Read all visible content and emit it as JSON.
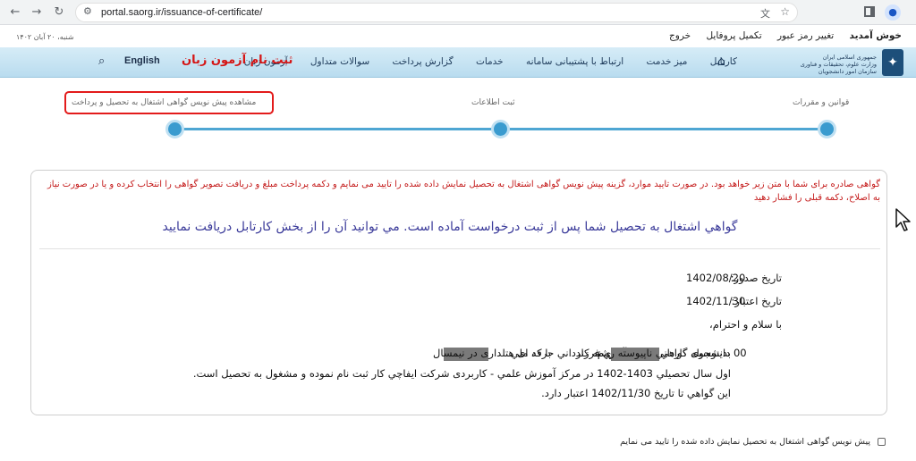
{
  "browser": {
    "url": "portal.saorg.ir/issuance-of-certificate/",
    "back_icon": "back-arrow-icon",
    "forward_icon": "forward-arrow-icon",
    "reload_icon": "reload-icon"
  },
  "topbar": {
    "welcome": "خوش آمدید",
    "change_password": "تغییر رمز عبور",
    "complete_profile": "تکمیل پروفایل",
    "logout": "خروج",
    "date": "شنبه، ۲۰ آبان ۱۴۰۲"
  },
  "logo": {
    "line1": "جمهوری اسلامی ایران",
    "line2": "وزارت علوم، تحقیقات و فناوری",
    "line3": "سازمان امور دانشجویان"
  },
  "nav": {
    "items": [
      "کارتابل",
      "میز خدمت",
      "ارتباط با پشتیبانی سامانه",
      "خدمات",
      "گزارش پرداخت",
      "سوالات متداول",
      "آزمون زبان"
    ],
    "register_language_exam": "ثبت نام آزمون زبان",
    "english": "English"
  },
  "stepper": {
    "steps": [
      "قوانین و مقررات",
      "ثبت اطلاعات",
      "مشاهده پیش نویس گواهی اشتغال به تحصیل و پرداخت"
    ],
    "active_index": 2
  },
  "content": {
    "warning": "گواهی صادره برای شما با متن زیر خواهد بود. در صورت تایید موارد، گزینه پیش نویس گواهی اشتغال به تحصیل نمایش داده شده را تایید می نمایم و دکمه پرداخت مبلغ و دریافت تصویر گواهی را انتخاب کرده و یا در صورت نیاز به اصلاح، دکمه قبلی را فشار دهید",
    "certificate_notice": "گواهي اشتغال به تحصيل شما پس از ثبت درخواست آماده است. مي توانيد آن را از بخش كارتابل دریافت نمایید",
    "issue_date_label": "تاريخ صدور:",
    "issue_date": "1402/08/20",
    "validity_date_label": "تاريخ اعتبار:",
    "validity_date": "1402/11/30",
    "greeting": "با سلام و احترام،",
    "body_part1": "بدينوسيله گواهي ميشود آقاي م",
    "body_part2": "ي فرزند",
    "body_part3": "با كد ملي",
    "body_part4": "00 دانشجوی كارداني ناپيوسته رشته كارداني حرفه ای هتلداری در نيمسال",
    "body_line2": "اول سال تحصيلي 1403-1402 در مركز آموزش علمي - كاربردی شركت ايفاچي كار ثبت نام نموده و مشغول به تحصيل است.",
    "body_line3": "اين گواهي تا تاريخ 1402/11/30 اعتبار دارد."
  },
  "confirm": {
    "label": "پیش نویس گواهی اشتغال به تحصیل نمایش داده شده را تایید می نمایم",
    "checked": false
  }
}
